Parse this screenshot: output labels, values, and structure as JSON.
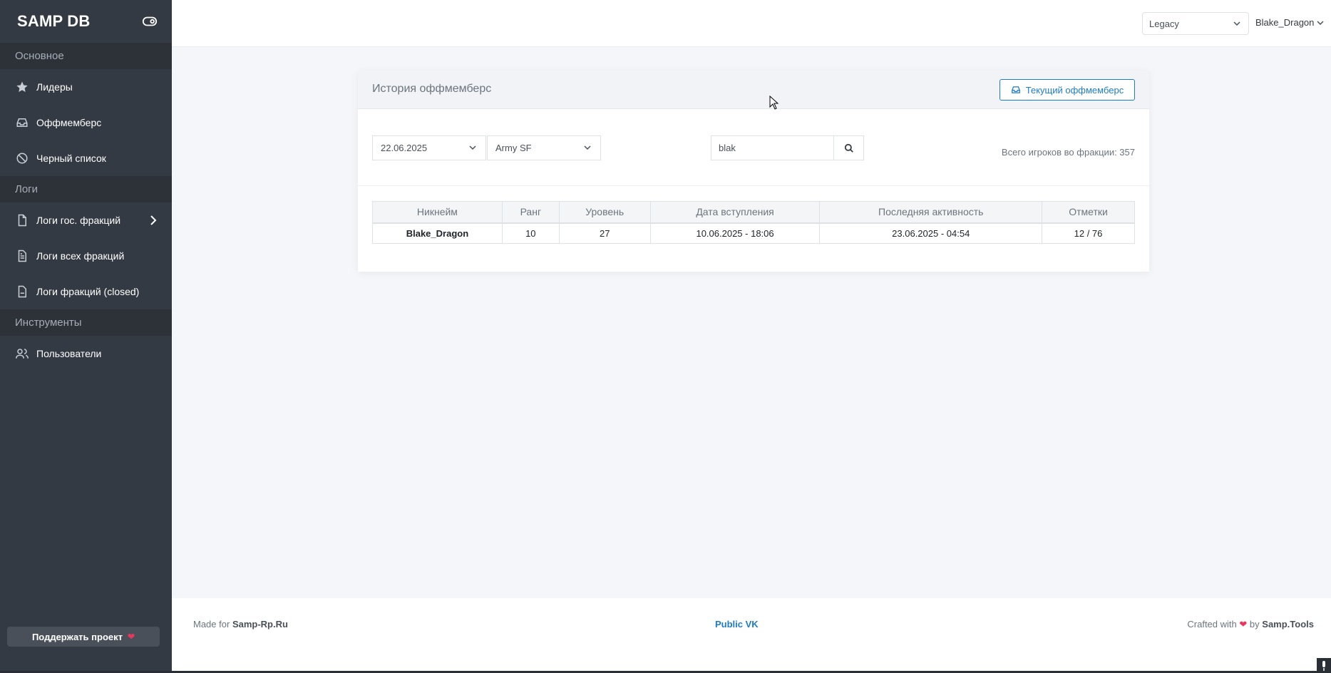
{
  "sidebar": {
    "brand": "SAMP DB",
    "sections": [
      {
        "label": "Основное"
      },
      {
        "label": "Логи"
      },
      {
        "label": "Инструменты"
      }
    ],
    "items": [
      {
        "label": "Лидеры",
        "icon": "star-icon"
      },
      {
        "label": "Оффмемберс",
        "icon": "inbox-icon"
      },
      {
        "label": "Черный список",
        "icon": "ban-icon"
      },
      {
        "label": "Логи гос. фракций",
        "icon": "file-icon"
      },
      {
        "label": "Логи всех фракций",
        "icon": "file-text-icon"
      },
      {
        "label": "Логи фракций (closed)",
        "icon": "file-minus-icon"
      },
      {
        "label": "Пользователи",
        "icon": "users-icon"
      }
    ],
    "support_label": "Поддержать проект"
  },
  "topbar": {
    "server": "Legacy",
    "user": "Blake_Dragon"
  },
  "card": {
    "title": "История оффмемберс",
    "current_button": "Текущий оффмемберс",
    "date": "22.06.2025",
    "faction": "Army SF",
    "search_value": "blak",
    "total": "Всего игроков во фракции: 357",
    "columns": [
      "Никнейм",
      "Ранг",
      "Уровень",
      "Дата вступления",
      "Последняя активность",
      "Отметки"
    ],
    "rows": [
      {
        "nick": "Blake_Dragon",
        "rank": "10",
        "level": "27",
        "joined": "10.06.2025 - 18:06",
        "last": "23.06.2025 - 04:54",
        "marks": "12 / 76"
      }
    ]
  },
  "footer": {
    "made_prefix": "Made for",
    "made_site": "Samp-Rp.Ru",
    "center_link": "Public VK",
    "crafted_prefix": "Crafted with",
    "crafted_by": "by",
    "crafted_site": "Samp.Tools"
  },
  "colors": {
    "sidebar_bg": "#343a43",
    "accent": "#1d7cc9",
    "heart": "#e8365d"
  }
}
